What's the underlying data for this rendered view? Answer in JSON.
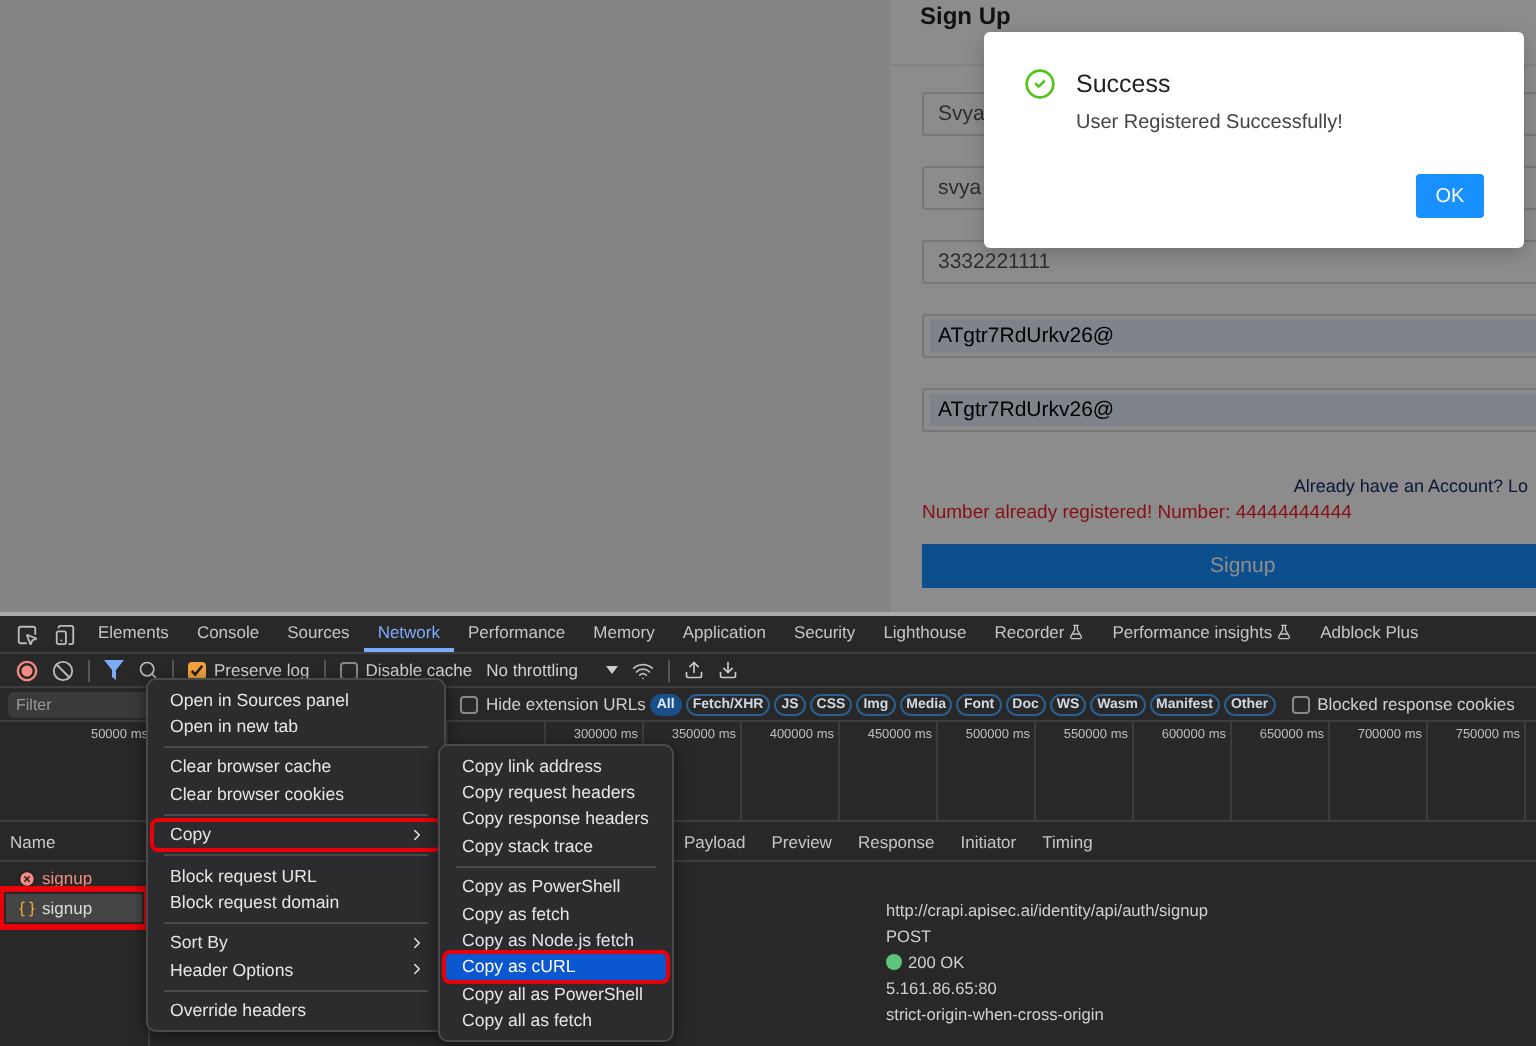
{
  "page": {
    "form": {
      "title": "Sign Up",
      "fields": [
        {
          "value": "Svya",
          "autofilled": false
        },
        {
          "value": "svya",
          "autofilled": false
        },
        {
          "value": "3332221111",
          "autofilled": false
        },
        {
          "value": "ATgtr7RdUrkv26@",
          "autofilled": true
        },
        {
          "value": "ATgtr7RdUrkv26@",
          "autofilled": true
        }
      ],
      "login_prompt": "Already have an Account? Lo",
      "error": "Number already registered! Number: 44444444444",
      "submit": "Signup"
    },
    "modal": {
      "title": "Success",
      "message": "User Registered Successfully!",
      "ok": "OK"
    }
  },
  "devtools": {
    "tabs": [
      {
        "label": "Elements",
        "selected": false,
        "experimental": false
      },
      {
        "label": "Console",
        "selected": false,
        "experimental": false
      },
      {
        "label": "Sources",
        "selected": false,
        "experimental": false
      },
      {
        "label": "Network",
        "selected": true,
        "experimental": false
      },
      {
        "label": "Performance",
        "selected": false,
        "experimental": false
      },
      {
        "label": "Memory",
        "selected": false,
        "experimental": false
      },
      {
        "label": "Application",
        "selected": false,
        "experimental": false
      },
      {
        "label": "Security",
        "selected": false,
        "experimental": false
      },
      {
        "label": "Lighthouse",
        "selected": false,
        "experimental": false
      },
      {
        "label": "Recorder",
        "selected": false,
        "experimental": true
      },
      {
        "label": "Performance insights",
        "selected": false,
        "experimental": true
      },
      {
        "label": "Adblock Plus",
        "selected": false,
        "experimental": false
      }
    ],
    "toolbar": {
      "preserve_log": {
        "label": "Preserve log",
        "checked": true
      },
      "disable_cache": {
        "label": "Disable cache",
        "checked": false
      },
      "throttling": "No throttling"
    },
    "filter": {
      "placeholder": "Filter",
      "hide_extension_urls": {
        "label": "Hide extension URLs",
        "checked": false
      },
      "chips": [
        {
          "label": "All",
          "selected": true
        },
        {
          "label": "Fetch/XHR",
          "selected": false
        },
        {
          "label": "JS",
          "selected": false
        },
        {
          "label": "CSS",
          "selected": false
        },
        {
          "label": "Img",
          "selected": false
        },
        {
          "label": "Media",
          "selected": false
        },
        {
          "label": "Font",
          "selected": false
        },
        {
          "label": "Doc",
          "selected": false
        },
        {
          "label": "WS",
          "selected": false
        },
        {
          "label": "Wasm",
          "selected": false
        },
        {
          "label": "Manifest",
          "selected": false
        },
        {
          "label": "Other",
          "selected": false
        }
      ],
      "blocked_cookies": {
        "label": "Blocked response cookies",
        "checked": false
      }
    },
    "timeline_ticks": [
      "50000 ms",
      "300000 ms",
      "350000 ms",
      "400000 ms",
      "450000 ms",
      "500000 ms",
      "550000 ms",
      "600000 ms",
      "650000 ms",
      "700000 ms",
      "750000 ms"
    ],
    "requests": {
      "header": "Name",
      "rows": [
        {
          "name": "signup",
          "kind": "error",
          "selected": false,
          "highlighted": false
        },
        {
          "name": "signup",
          "kind": "fetch",
          "selected": true,
          "highlighted": true
        }
      ]
    },
    "detail_tabs": [
      "Payload",
      "Preview",
      "Response",
      "Initiator",
      "Timing"
    ],
    "details": [
      {
        "kind": "text",
        "text": "http://crapi.apisec.ai/identity/api/auth/signup"
      },
      {
        "kind": "text",
        "text": "POST"
      },
      {
        "kind": "status",
        "text": "200 OK",
        "color": "#5ec477"
      },
      {
        "kind": "text",
        "text": "5.161.86.65:80"
      },
      {
        "kind": "text",
        "text": "strict-origin-when-cross-origin"
      }
    ],
    "context_menu": [
      {
        "kind": "item",
        "label": "Open in Sources panel",
        "submenu": false,
        "highlighted": false
      },
      {
        "kind": "item",
        "label": "Open in new tab",
        "submenu": false,
        "highlighted": false
      },
      {
        "kind": "separator"
      },
      {
        "kind": "item",
        "label": "Clear browser cache",
        "submenu": false,
        "highlighted": false
      },
      {
        "kind": "item",
        "label": "Clear browser cookies",
        "submenu": false,
        "highlighted": false
      },
      {
        "kind": "separator"
      },
      {
        "kind": "item",
        "label": "Copy",
        "submenu": true,
        "highlighted": true
      },
      {
        "kind": "separator"
      },
      {
        "kind": "item",
        "label": "Block request URL",
        "submenu": false,
        "highlighted": false
      },
      {
        "kind": "item",
        "label": "Block request domain",
        "submenu": false,
        "highlighted": false
      },
      {
        "kind": "separator"
      },
      {
        "kind": "item",
        "label": "Sort By",
        "submenu": true,
        "highlighted": false
      },
      {
        "kind": "item",
        "label": "Header Options",
        "submenu": true,
        "highlighted": false
      },
      {
        "kind": "separator"
      },
      {
        "kind": "item",
        "label": "Override headers",
        "submenu": false,
        "highlighted": false
      }
    ],
    "copy_submenu": [
      {
        "kind": "item",
        "label": "Copy link address",
        "selected": false,
        "highlighted": false
      },
      {
        "kind": "item",
        "label": "Copy request headers",
        "selected": false,
        "highlighted": false
      },
      {
        "kind": "item",
        "label": "Copy response headers",
        "selected": false,
        "highlighted": false
      },
      {
        "kind": "item",
        "label": "Copy stack trace",
        "selected": false,
        "highlighted": false
      },
      {
        "kind": "separator"
      },
      {
        "kind": "item",
        "label": "Copy as PowerShell",
        "selected": false,
        "highlighted": false
      },
      {
        "kind": "item",
        "label": "Copy as fetch",
        "selected": false,
        "highlighted": false
      },
      {
        "kind": "item",
        "label": "Copy as Node.js fetch",
        "selected": false,
        "highlighted": false
      },
      {
        "kind": "item",
        "label": "Copy as cURL",
        "selected": true,
        "highlighted": true
      },
      {
        "kind": "item",
        "label": "Copy all as PowerShell",
        "selected": false,
        "highlighted": false
      },
      {
        "kind": "item",
        "label": "Copy all as fetch",
        "selected": false,
        "highlighted": false
      }
    ]
  }
}
